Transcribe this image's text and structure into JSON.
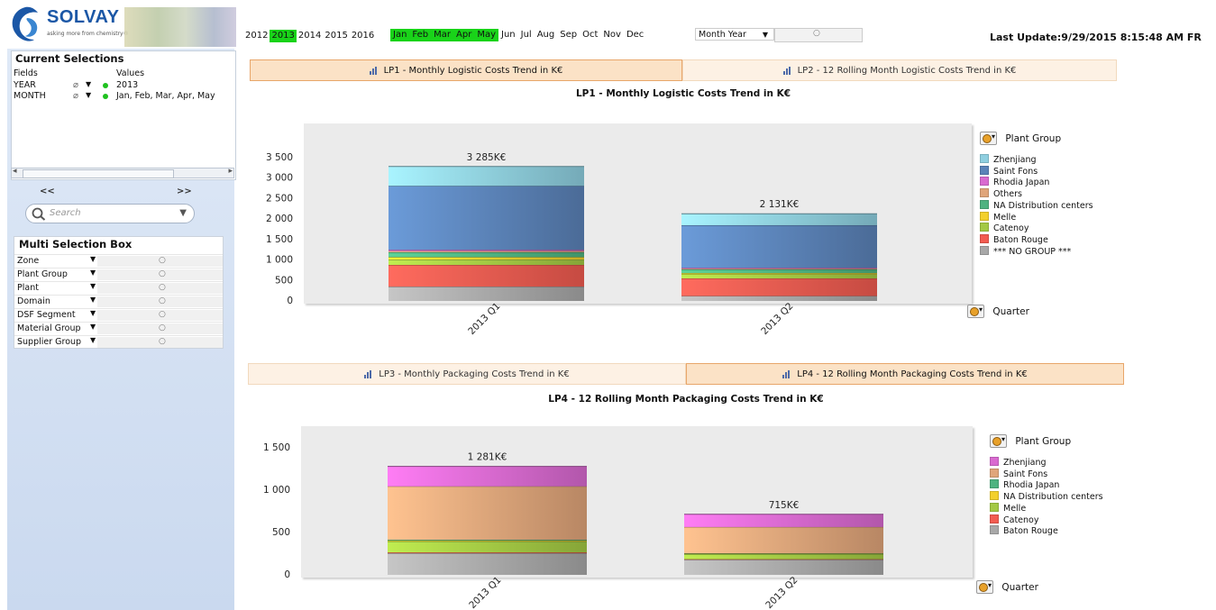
{
  "logo": {
    "name": "SOLVAY",
    "tagline": "asking more from chemistry®"
  },
  "years": [
    {
      "label": "2012",
      "selected": false
    },
    {
      "label": "2013",
      "selected": true
    },
    {
      "label": "2014",
      "selected": false
    },
    {
      "label": "2015",
      "selected": false
    },
    {
      "label": "2016",
      "selected": false
    }
  ],
  "months": [
    {
      "label": "Jan",
      "selected": true
    },
    {
      "label": "Feb",
      "selected": true
    },
    {
      "label": "Mar",
      "selected": true
    },
    {
      "label": "Apr",
      "selected": true
    },
    {
      "label": "May",
      "selected": true
    },
    {
      "label": "Jun",
      "selected": false
    },
    {
      "label": "Jul",
      "selected": false
    },
    {
      "label": "Aug",
      "selected": false
    },
    {
      "label": "Sep",
      "selected": false
    },
    {
      "label": "Oct",
      "selected": false
    },
    {
      "label": "Nov",
      "selected": false
    },
    {
      "label": "Dec",
      "selected": false
    }
  ],
  "month_year_dropdown": "Month Year",
  "last_update": "Last Update:9/29/2015 8:15:48 AM FR",
  "current_selections": {
    "title": "Current Selections",
    "col_fields": "Fields",
    "col_values": "Values",
    "rows": [
      {
        "field": "YEAR",
        "value": "2013"
      },
      {
        "field": "MONTH",
        "value": "Jan, Feb, Mar, Apr, May"
      }
    ]
  },
  "nav": {
    "prev": "<<",
    "next": ">>"
  },
  "search": {
    "placeholder": "Search"
  },
  "multi_selection": {
    "title": "Multi Selection Box",
    "fields": [
      "Zone",
      "Plant Group",
      "Plant",
      "Domain",
      "DSF Segment",
      "Material Group",
      "Supplier Group"
    ]
  },
  "tabs_top": [
    {
      "label": "LP1 - Monthly Logistic Costs Trend in K€",
      "active": true
    },
    {
      "label": "LP2 - 12 Rolling Month Logistic Costs Trend in K€",
      "active": false
    }
  ],
  "tabs_bottom": [
    {
      "label": "LP3 - Monthly Packaging Costs Trend in K€",
      "active": false
    },
    {
      "label": "LP4 - 12 Rolling Month Packaging Costs Trend in K€",
      "active": true
    }
  ],
  "colors": {
    "Zhenjiang": "#8fcfe0",
    "Saint Fons": "#5b83b8",
    "Rhodia Japan": "#d96ad0",
    "Others": "#e0a57a",
    "NA Distribution centers": "#4fb381",
    "Melle": "#f3d02c",
    "Catenoy": "#a3c944",
    "Baton Rouge": "#f25b50",
    "*** NO GROUP ***": "#a8a8a8"
  },
  "chart_data": [
    {
      "type": "bar",
      "stacked": true,
      "title": "LP1 - Monthly Logistic Costs Trend in K€",
      "categories": [
        "2013 Q1",
        "2013 Q2"
      ],
      "totals_labels": [
        "3 285K€",
        "2 131K€"
      ],
      "ylim": [
        0,
        3800
      ],
      "yticks": [
        0,
        500,
        1000,
        1500,
        2000,
        2500,
        3000,
        3500
      ],
      "ytick_labels": [
        "0",
        "500",
        "1 000",
        "1 500",
        "2 000",
        "2 500",
        "3 000",
        "3 500"
      ],
      "legend_title": "Plant Group",
      "xaxis_label": "Quarter",
      "legend": [
        "Zhenjiang",
        "Saint Fons",
        "Rhodia Japan",
        "Others",
        "NA Distribution centers",
        "Melle",
        "Catenoy",
        "Baton Rouge",
        "*** NO GROUP ***"
      ],
      "series": [
        {
          "name": "*** NO GROUP ***",
          "colorKey": "*** NO GROUP ***",
          "values": [
            350,
            120
          ]
        },
        {
          "name": "Baton Rouge",
          "colorKey": "Baton Rouge",
          "values": [
            530,
            430
          ]
        },
        {
          "name": "Catenoy",
          "colorKey": "Catenoy",
          "values": [
            130,
            100
          ]
        },
        {
          "name": "Melle",
          "colorKey": "Melle",
          "values": [
            60,
            30
          ]
        },
        {
          "name": "NA Distribution centers",
          "colorKey": "NA Distribution centers",
          "values": [
            120,
            90
          ]
        },
        {
          "name": "Others",
          "colorKey": "Others",
          "values": [
            30,
            20
          ]
        },
        {
          "name": "Rhodia Japan",
          "colorKey": "Rhodia Japan",
          "values": [
            30,
            20
          ]
        },
        {
          "name": "Saint Fons",
          "colorKey": "Saint Fons",
          "values": [
            1560,
            1040
          ]
        },
        {
          "name": "Zhenjiang",
          "colorKey": "Zhenjiang",
          "values": [
            475,
            281
          ]
        }
      ]
    },
    {
      "type": "bar",
      "stacked": true,
      "title": "LP4 - 12 Rolling Month Packaging Costs Trend in K€",
      "categories": [
        "2013 Q1",
        "2013 Q2"
      ],
      "totals_labels": [
        "1 281K€",
        "715K€"
      ],
      "ylim": [
        0,
        1650
      ],
      "yticks": [
        0,
        500,
        1000,
        1500
      ],
      "ytick_labels": [
        "0",
        "500",
        "1 000",
        "1 500"
      ],
      "legend_title": "Plant Group",
      "xaxis_label": "Quarter",
      "legend": [
        "Zhenjiang",
        "Saint Fons",
        "Rhodia Japan",
        "NA Distribution centers",
        "Melle",
        "Catenoy",
        "Baton Rouge"
      ],
      "series": [
        {
          "name": "Baton Rouge",
          "colorKey": "*** NO GROUP ***",
          "values": [
            255,
            180
          ]
        },
        {
          "name": "Catenoy",
          "colorKey": "Baton Rouge",
          "values": [
            10,
            5
          ]
        },
        {
          "name": "Melle",
          "colorKey": "Catenoy",
          "values": [
            130,
            60
          ]
        },
        {
          "name": "NA Distribution centers",
          "colorKey": "Melle",
          "values": [
            10,
            5
          ]
        },
        {
          "name": "Rhodia Japan",
          "colorKey": "NA Distribution centers",
          "values": [
            10,
            5
          ]
        },
        {
          "name": "Saint Fons",
          "colorKey": "Others",
          "values": [
            630,
            310
          ]
        },
        {
          "name": "Zhenjiang",
          "colorKey": "Rhodia Japan",
          "values": [
            236,
            150
          ]
        }
      ]
    }
  ]
}
